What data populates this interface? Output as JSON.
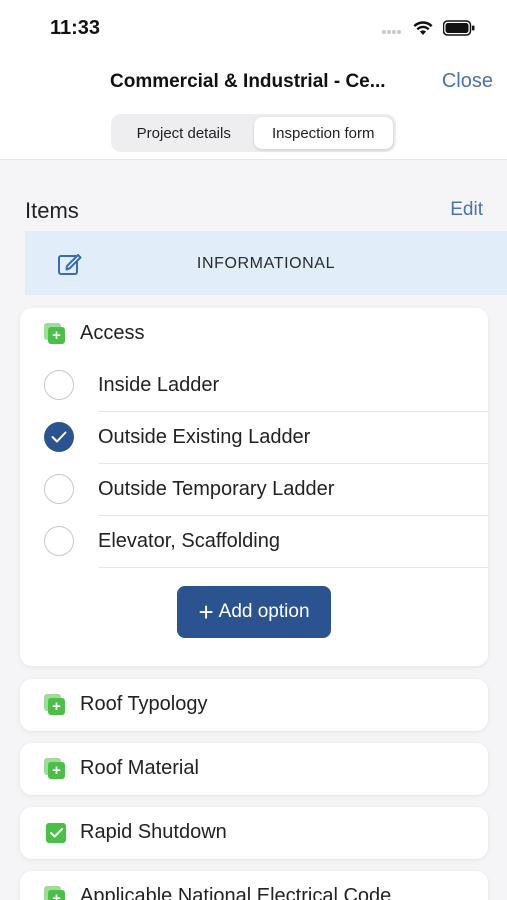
{
  "status_bar": {
    "time": "11:33"
  },
  "header": {
    "title": "Commercial & Industrial - Ce...",
    "close_label": "Close",
    "tabs": [
      {
        "label": "Project details",
        "active": false
      },
      {
        "label": "Inspection form",
        "active": true
      }
    ]
  },
  "items": {
    "title": "Items",
    "edit_label": "Edit",
    "informational_label": "INFORMATIONAL"
  },
  "access_card": {
    "title": "Access",
    "options": [
      {
        "label": "Inside Ladder",
        "checked": false
      },
      {
        "label": "Outside Existing Ladder",
        "checked": true
      },
      {
        "label": "Outside Temporary Ladder",
        "checked": false
      },
      {
        "label": "Elevator, Scaffolding",
        "checked": false
      }
    ],
    "add_option_label": "Add option"
  },
  "sections": [
    {
      "title": "Roof Typology",
      "icon": "add-square-icon"
    },
    {
      "title": "Roof Material",
      "icon": "add-square-icon"
    },
    {
      "title": "Rapid Shutdown",
      "icon": "checkbox-checked-icon"
    },
    {
      "title": "Applicable National Electrical Code",
      "icon": "add-square-icon"
    }
  ],
  "colors": {
    "accent": "#2b5390",
    "link": "#4a72b0",
    "banner": "#e1edf8",
    "green": "#4cbf49"
  }
}
